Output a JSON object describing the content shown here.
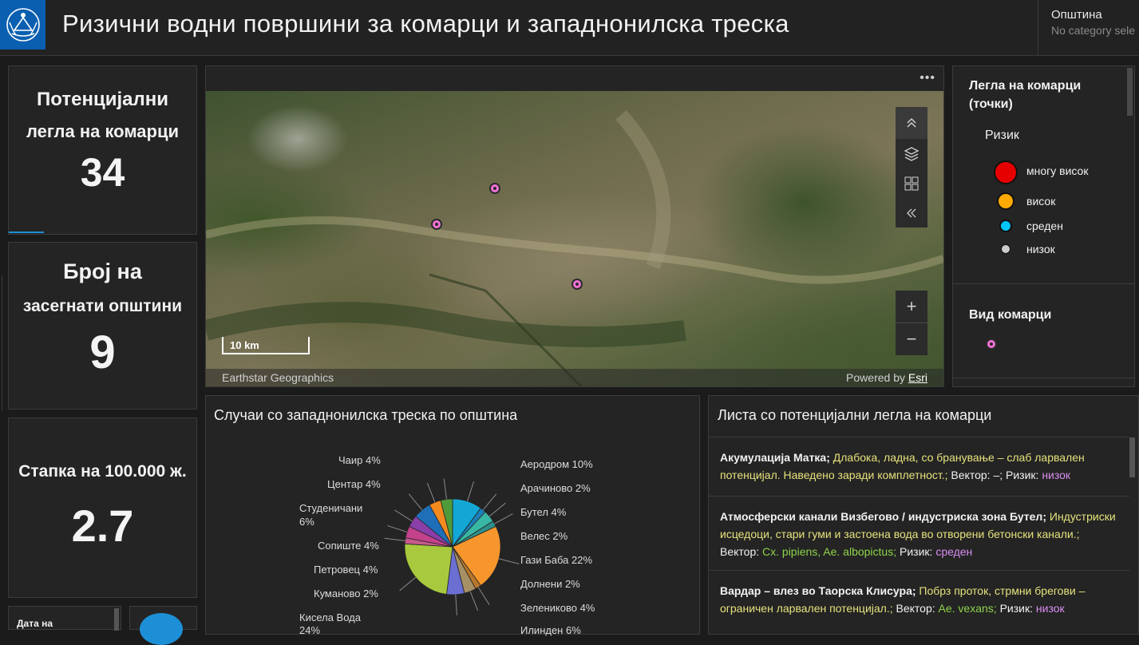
{
  "header": {
    "title": "Ризични водни површини за комарци и западнонилска треска",
    "selector_label": "Општина",
    "selector_value": "No category sele"
  },
  "indicators": [
    {
      "title_line1": "Потенцијални",
      "title_line2": "легла на комарци",
      "value": "34"
    },
    {
      "title_line1": "Број на",
      "title_line2": "засегнати општини",
      "value": "9"
    },
    {
      "title": "Стапка на 100.000 ж.",
      "value": "2.7"
    }
  ],
  "date_card": {
    "label": "Дата на"
  },
  "map": {
    "menu_icon": "more-icon",
    "scale_label": "10 km",
    "attribution_left": "Earthstar Geographics",
    "attribution_powered": "Powered by",
    "attribution_link": "Esri",
    "toolbar_icons": [
      "collapse-up-icon",
      "layers-icon",
      "basemap-gallery-icon",
      "collapse-left-icon"
    ],
    "zoom_in": "+",
    "zoom_out": "−",
    "pin_color": "#f272d6"
  },
  "legend": {
    "section1_title": "Легла на комарци (точки)",
    "risk_label": "Ризик",
    "items": [
      {
        "label": "многу висок",
        "color": "#e60000"
      },
      {
        "label": "висок",
        "color": "#ffaa00"
      },
      {
        "label": "среден",
        "color": "#00c5ff"
      },
      {
        "label": "низок",
        "color": "#cccccc"
      }
    ],
    "section2_title": "Вид комарци",
    "vid_color": "#f272d6"
  },
  "pie": {
    "title": "Случаи со западнонилска треска по општина"
  },
  "chart_data": {
    "type": "pie",
    "title": "Случаи со западнонилска треска по општина",
    "slices": [
      {
        "label": "Аеродром",
        "value": 10,
        "pct": "10%",
        "color": "#13a7d6"
      },
      {
        "label": "Арачиново",
        "value": 2,
        "pct": "2%",
        "color": "#1b7fb8"
      },
      {
        "label": "Бутел",
        "value": 4,
        "pct": "4%",
        "color": "#38b7a4"
      },
      {
        "label": "Велес",
        "value": 2,
        "pct": "2%",
        "color": "#2f8f8a"
      },
      {
        "label": "Гази Баба",
        "value": 22,
        "pct": "22%",
        "color": "#f7962d"
      },
      {
        "label": "Долнени",
        "value": 2,
        "pct": "2%",
        "color": "#b8772a"
      },
      {
        "label": "Зелениково",
        "value": 4,
        "pct": "4%",
        "color": "#a89066"
      },
      {
        "label": "Илинден",
        "value": 6,
        "pct": "6%",
        "color": "#6b6fd1"
      },
      {
        "label": "Кисела Вода",
        "value": 24,
        "pct": "24%",
        "color": "#a8c93e"
      },
      {
        "label": "Куманово",
        "value": 2,
        "pct": "2%",
        "color": "#c75a8a"
      },
      {
        "label": "Петровец",
        "value": 4,
        "pct": "4%",
        "color": "#c4418c"
      },
      {
        "label": "Сопиште",
        "value": 4,
        "pct": "4%",
        "color": "#8a3fa8"
      },
      {
        "label": "Студеничани",
        "value": 6,
        "pct": "6%",
        "color": "#1f6fb8"
      },
      {
        "label": "Центар",
        "value": 4,
        "pct": "4%",
        "color": "#f28a1e"
      },
      {
        "label": "Чаир",
        "value": 4,
        "pct": "4%",
        "color": "#4f9b3a"
      }
    ]
  },
  "pie_labels": {
    "r0": "Аеродром 10%",
    "r1": "Арачиново 2%",
    "r2": "Бутел 4%",
    "r3": "Велес 2%",
    "r4": "Гази Баба 22%",
    "r5": "Долнени 2%",
    "r6": "Зелениково 4%",
    "r7": "Илинден 6%",
    "l0": "Чаир 4%",
    "l1": "Центар 4%",
    "l2a": "Студеничани",
    "l2b": "6%",
    "l3": "Сопиште 4%",
    "l4": "Петровец 4%",
    "l5": "Куманово 2%",
    "l6a": "Кисела Вода",
    "l6b": "24%"
  },
  "list": {
    "title": "Листа со потенцијални легла на комарци",
    "vector_label": "Вектор:",
    "risk_label": "Ризик:",
    "items": [
      {
        "name": "Акумулација Матка;",
        "desc": "Длабока, ладна, со бранување – слаб ларвален потенцијал. Наведено заради комплетност.;",
        "vector": "–;",
        "risk": "низок"
      },
      {
        "name": "Атмосферски канали Визбегово / индустриска зона Бутел;",
        "desc": "Индустриски исцедоци, стари гуми и застоена вода во отворени бетонски канали.;",
        "vector": "Cx. pipiens, Ae. albopictus;",
        "risk": "среден"
      },
      {
        "name": "Вардар – влез во Таорска Клисура;",
        "desc": "Побрз проток, стрмни брегови – ограничен ларвален потенцијал.;",
        "vector": "Ae. vexans;",
        "risk": "низок"
      }
    ]
  }
}
